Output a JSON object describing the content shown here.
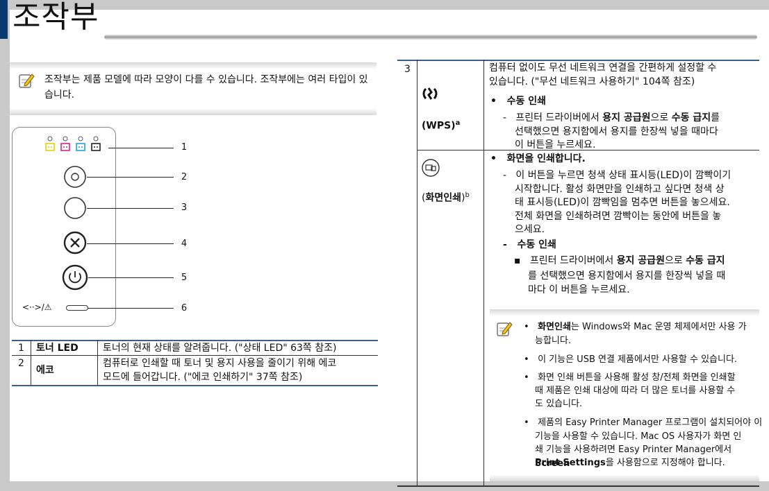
{
  "page_title": "조작부",
  "note": {
    "icon": "note-pencil-icon",
    "text": "조작부는 제품 모델에 따라 모양이 다를 수 있습니다. 조작부에는 여러 타입이 있습니다."
  },
  "panel": {
    "led_icons": [
      "toner-yellow-icon",
      "toner-magenta-icon",
      "toner-cyan-icon",
      "toner-black-icon"
    ],
    "callouts": [
      "1",
      "2",
      "3",
      "4",
      "5",
      "6"
    ],
    "status_symbol": "<··>/⚠"
  },
  "left_table": {
    "rows": [
      {
        "num": "1",
        "name": "토너 LED",
        "desc": "토너의 현재 상태를 알려줍니다. (\"상태 LED\" 63쪽 참조)"
      },
      {
        "num": "2",
        "name": "에코",
        "desc_lines": [
          "컴퓨터로 인쇄할 때 토너 및 용지 사용을 줄이기 위해 에코",
          "모드에 들어갑니다. (\"에코 인쇄하기\" 37쪽 참조)"
        ]
      }
    ]
  },
  "right_table": {
    "row3": {
      "num": "3",
      "icon": "wps-icon",
      "name": "(WPS)",
      "sup": "a",
      "intro_lines": [
        "컴퓨터 없이도 무선 네트워크 연결을 간편하게 설정할 수",
        "있습니다. (\"무선 네트워크 사용하기\" 104쪽 참조)"
      ],
      "bullet": "수동 인쇄",
      "dash_lines": [
        "프린터 드라이버에서 ",
        "용지 공급원",
        "으로 ",
        "수동 급지",
        "를",
        "선택했으면 용지함에서 용지를 한장씩 넣을 때마다",
        "이 버튼을 누르세요."
      ]
    },
    "row_print_screen": {
      "icon": "print-screen-icon",
      "name_open": "(",
      "name": "화면인쇄",
      "name_close": ")",
      "sup": "b",
      "bullet": "화면을 인쇄합니다.",
      "dash1_lines": [
        "이 버튼을 누르면 청색 상태 표시등(LED)이 깜빡이기",
        "시작합니다. 활성 화면만을 인쇄하고 싶다면 청색 상",
        "태 표시등(LED)이 깜빡임을 멈추면 버튼을 놓으세요.",
        "전체 화면을 인쇄하려면 깜빡이는 동안에 버튼을 놓",
        "으세요."
      ],
      "dash2": "수동 인쇄",
      "sub_lines": [
        "프린터 드라이버에서 ",
        "용지 공급원",
        "으로 ",
        "수동 급지",
        "를 선택했으면 용지함에서 용지를 한장씩 넣을 때",
        "마다 이 버튼을 누르세요."
      ]
    }
  },
  "tips": {
    "icon": "note-pencil-icon",
    "items": [
      {
        "bold": "화면인쇄",
        "rest_lines": [
          "는 Windows와 Mac 운영 체제에서만 사용 가",
          "능합니다."
        ]
      },
      {
        "lines": [
          "이 기능은 USB 연결 제품에서만 사용할 수 있습니다."
        ]
      },
      {
        "lines": [
          "화면 인쇄 버튼을 사용해 활성 창/전체 화면을 인쇄할",
          "때 제품은 인쇄 대상에 따라 더 많은 토너를 사용할 수",
          "도 있습니다."
        ]
      },
      {
        "lines": [
          "제품의 Easy Printer Manager 프로그램이 설치되어야 이",
          "기능을 사용할 수 있습니다. Mac OS 사용자가 화면 인",
          "쇄 기능을 사용하려면 Easy Printer Manager에서 "
        ],
        "bold_tail": "Screen",
        "bold_line2": "Print Settings",
        "tail": "을 사용함으로 지정해야 합니다."
      }
    ]
  }
}
